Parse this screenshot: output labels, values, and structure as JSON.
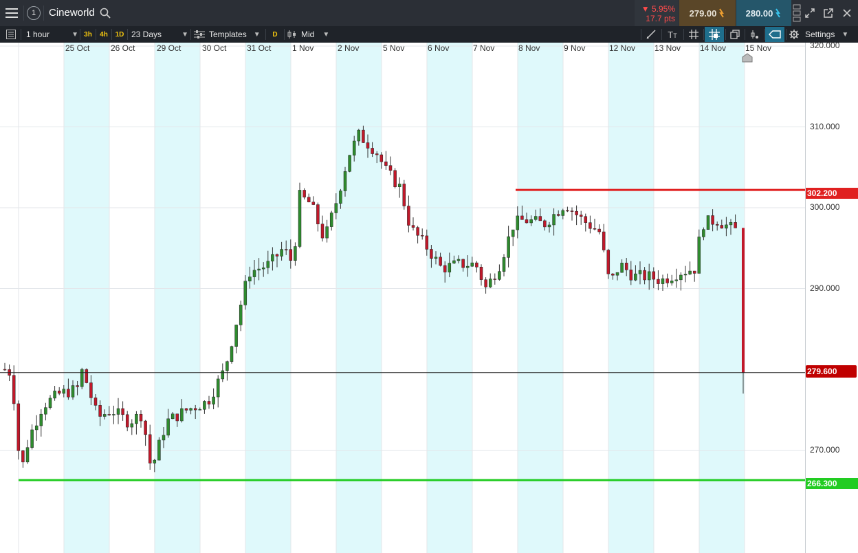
{
  "header": {
    "index_label": "1",
    "symbol": "Cineworld",
    "change_pct": "▼ 5.95%",
    "change_pts": "17.7 pts",
    "sell_price": "279.00",
    "buy_price": "280.00"
  },
  "toolbar": {
    "interval": "1 hour",
    "tf_3h": "3h",
    "tf_4h": "4h",
    "tf_1d": "1D",
    "range": "23 Days",
    "templates": "Templates",
    "d_label": "D",
    "price_mode": "Mid",
    "settings": "Settings"
  },
  "chart": {
    "date_labels": [
      "25 Oct",
      "26 Oct",
      "29 Oct",
      "30 Oct",
      "31 Oct",
      "1 Nov",
      "2 Nov",
      "5 Nov",
      "6 Nov",
      "7 Nov",
      "8 Nov",
      "9 Nov",
      "12 Nov",
      "13 Nov",
      "14 Nov",
      "15 Nov"
    ],
    "price_ticks": [
      "320.000",
      "310.000",
      "300.000",
      "290.000",
      "270.000"
    ],
    "resistance_label": "302.200",
    "current_label": "279.600",
    "support_label": "266.300",
    "colors": {
      "up": "#2e8b2e",
      "down": "#c0182a",
      "resistance": "#e02020",
      "support": "#22cc22",
      "current": "#c00000",
      "band": "#dff9fb"
    }
  }
}
